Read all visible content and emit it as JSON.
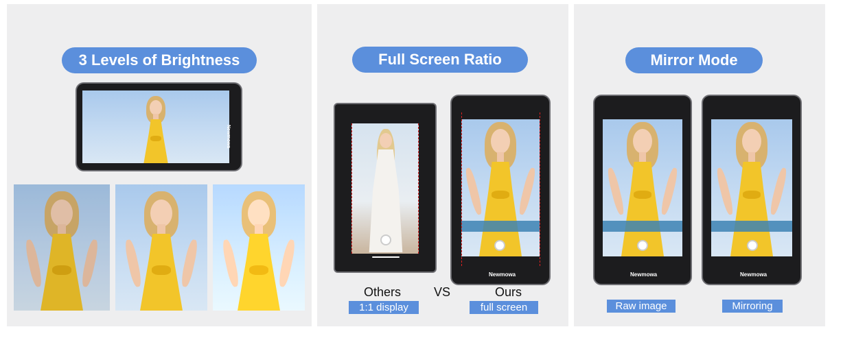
{
  "panels": [
    {
      "title": "3 Levels of Brightness"
    },
    {
      "title": "Full Screen Ratio",
      "left_caption": "Others",
      "vs_label": "VS",
      "right_caption": "Ours",
      "left_tag": "1:1 display",
      "right_tag": "full screen",
      "brand": "Newmowa"
    },
    {
      "title": "Mirror Mode",
      "left_tag": "Raw image",
      "right_tag": "Mirroring",
      "brand": "Newmowa"
    }
  ],
  "landscape_brand": "Newmowa",
  "colors": {
    "accent": "#5b8fdc",
    "dress": "#f2c52a",
    "panel": "#eeeeef",
    "guide": "#e02020"
  }
}
